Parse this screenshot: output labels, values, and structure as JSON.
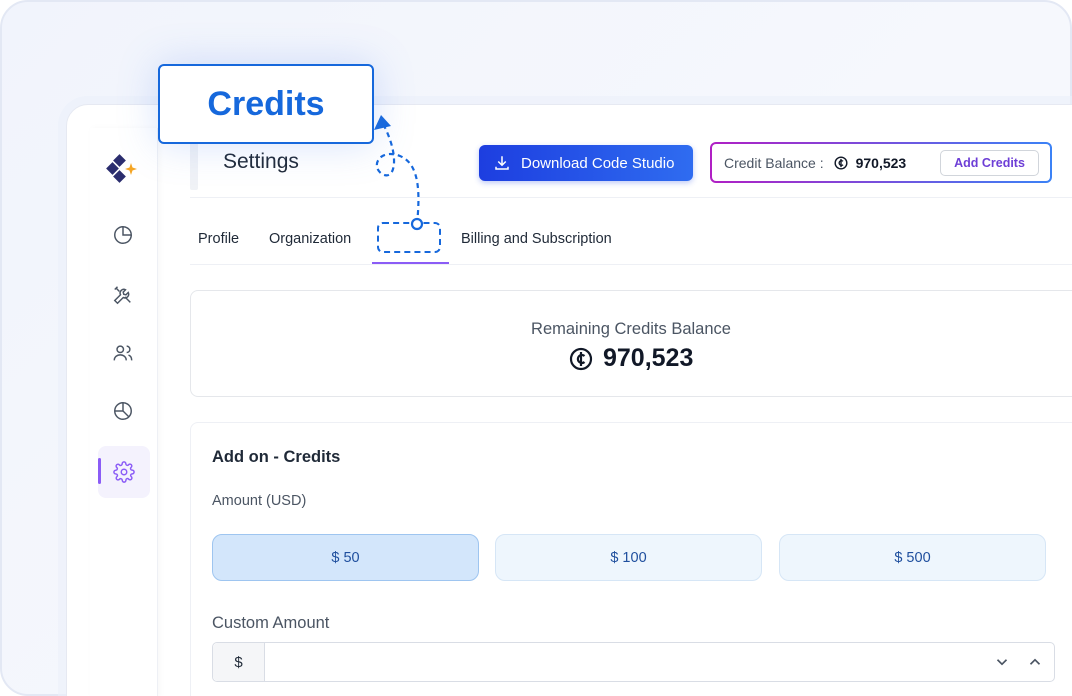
{
  "callout": {
    "label": "Credits"
  },
  "header": {
    "title": "Settings",
    "download_label": "Download Code Studio",
    "credit_balance_label": "Credit Balance :",
    "credit_balance_value": "970,523",
    "add_credits_label": "Add Credits"
  },
  "tabs": [
    {
      "label": "Profile"
    },
    {
      "label": "Organization"
    },
    {
      "label": ""
    },
    {
      "label": "Billing and Subscription"
    }
  ],
  "balance": {
    "title": "Remaining Credits Balance",
    "amount": "970,523"
  },
  "addon": {
    "title": "Add on - Credits",
    "amount_label": "Amount (USD)",
    "options": [
      "$ 50",
      "$ 100",
      "$ 500"
    ],
    "selected_index": 0,
    "custom_label": "Custom Amount",
    "currency_prefix": "$",
    "custom_value": ""
  },
  "sidebar": {
    "items": [
      {
        "icon": "pie-chart-icon"
      },
      {
        "icon": "tools-icon"
      },
      {
        "icon": "users-icon"
      },
      {
        "icon": "analytics-icon"
      },
      {
        "icon": "gear-icon",
        "active": true
      }
    ]
  },
  "colors": {
    "accent": "#1668dc",
    "primary_button": "#1d3ee0",
    "active_nav": "#8b5cf6",
    "selected_option": "#d3e6fb"
  }
}
